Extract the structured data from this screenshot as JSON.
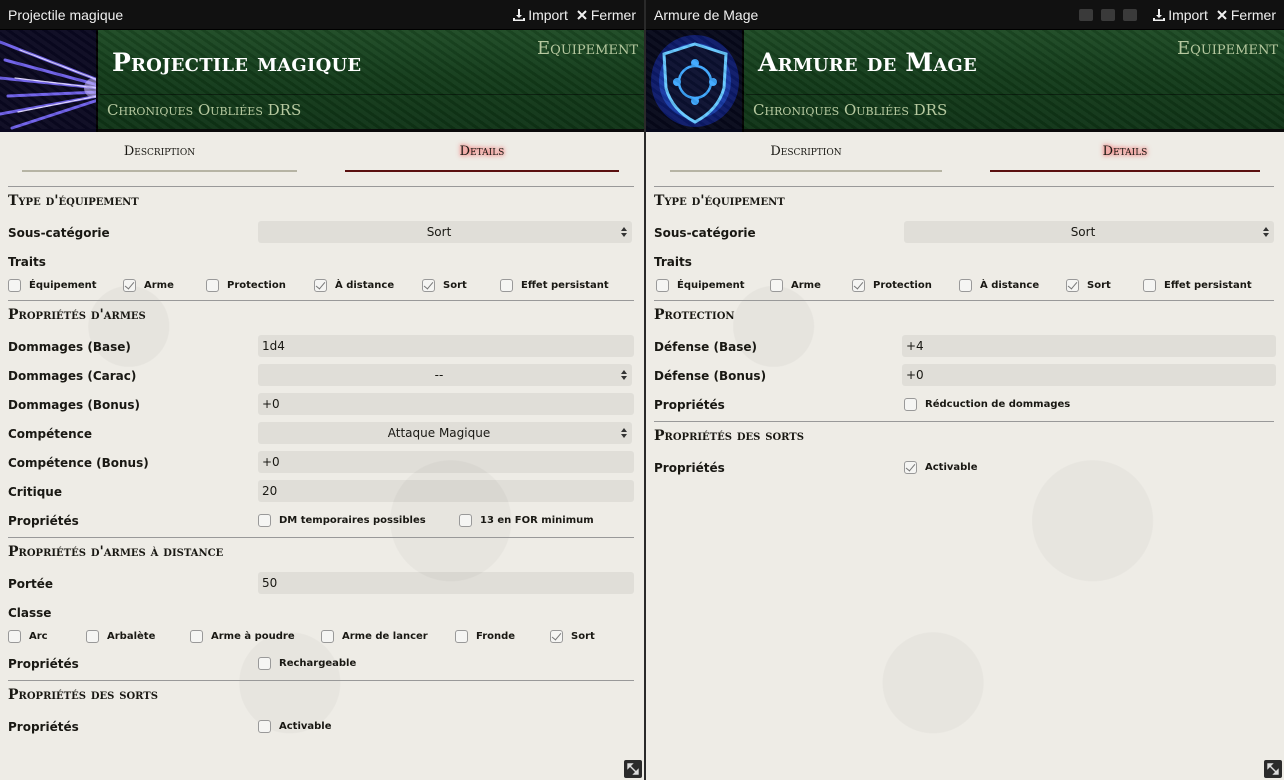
{
  "left": {
    "window_title": "Projectile magique",
    "import_label": "Import",
    "close_label": "Fermer",
    "name": "Projectile magique",
    "item_type": "Equipement",
    "source": "Chroniques Oubliées DRS",
    "tabs": [
      "Description",
      "Details"
    ],
    "equip_section": "Type d'équipement",
    "subcat_label": "Sous-catégorie",
    "subcat_value": "Sort",
    "traits_label": "Traits",
    "traits": [
      {
        "label": "Équipement",
        "checked": false
      },
      {
        "label": "Arme",
        "checked": true
      },
      {
        "label": "Protection",
        "checked": false
      },
      {
        "label": "À distance",
        "checked": true
      },
      {
        "label": "Sort",
        "checked": true
      },
      {
        "label": "Effet persistant",
        "checked": false
      }
    ],
    "weapon_section": "Propriétés d'armes",
    "dmg_base_label": "Dommages (Base)",
    "dmg_base_value": "1d4",
    "dmg_carac_label": "Dommages (Carac)",
    "dmg_carac_value": "--",
    "dmg_bonus_label": "Dommages (Bonus)",
    "dmg_bonus_value": "+0",
    "skill_label": "Compétence",
    "skill_value": "Attaque Magique",
    "skill_bonus_label": "Compétence (Bonus)",
    "skill_bonus_value": "+0",
    "crit_label": "Critique",
    "crit_value": "20",
    "props_label": "Propriétés",
    "weapon_props": [
      {
        "label": "DM temporaires possibles",
        "checked": false
      },
      {
        "label": "13 en FOR minimum",
        "checked": false
      }
    ],
    "ranged_section": "Propriétés d'armes à distance",
    "range_label": "Portée",
    "range_value": "50",
    "class_label": "Classe",
    "classes": [
      {
        "label": "Arc",
        "checked": false
      },
      {
        "label": "Arbalète",
        "checked": false
      },
      {
        "label": "Arme à poudre",
        "checked": false
      },
      {
        "label": "Arme de lancer",
        "checked": false
      },
      {
        "label": "Fronde",
        "checked": false
      },
      {
        "label": "Sort",
        "checked": true
      }
    ],
    "ranged_props_label": "Propriétés",
    "ranged_props": [
      {
        "label": "Rechargeable",
        "checked": false
      }
    ],
    "spell_section": "Propriétés des sorts",
    "spell_props_label": "Propriétés",
    "spell_props": [
      {
        "label": "Activable",
        "checked": false
      }
    ]
  },
  "right": {
    "window_title": "Armure de Mage",
    "import_label": "Import",
    "close_label": "Fermer",
    "name": "Armure de Mage",
    "item_type": "Equipement",
    "source": "Chroniques Oubliées DRS",
    "tabs": [
      "Description",
      "Details"
    ],
    "equip_section": "Type d'équipement",
    "subcat_label": "Sous-catégorie",
    "subcat_value": "Sort",
    "traits_label": "Traits",
    "traits": [
      {
        "label": "Équipement",
        "checked": false
      },
      {
        "label": "Arme",
        "checked": false
      },
      {
        "label": "Protection",
        "checked": true
      },
      {
        "label": "À distance",
        "checked": false
      },
      {
        "label": "Sort",
        "checked": true
      },
      {
        "label": "Effet persistant",
        "checked": false
      }
    ],
    "protection_section": "Protection",
    "def_base_label": "Défense (Base)",
    "def_base_value": "+4",
    "def_bonus_label": "Défense (Bonus)",
    "def_bonus_value": "+0",
    "prot_props_label": "Propriétés",
    "prot_props": [
      {
        "label": "Rédcuction de dommages",
        "checked": false
      }
    ],
    "spell_section": "Propriétés des sorts",
    "spell_props_label": "Propriétés",
    "spell_props": [
      {
        "label": "Activable",
        "checked": true
      }
    ]
  },
  "colors": {
    "header_green": "#123a19",
    "header_text": "#b7c9a0",
    "active_tab_glow": "#e44",
    "parchment": "#eeece6"
  }
}
